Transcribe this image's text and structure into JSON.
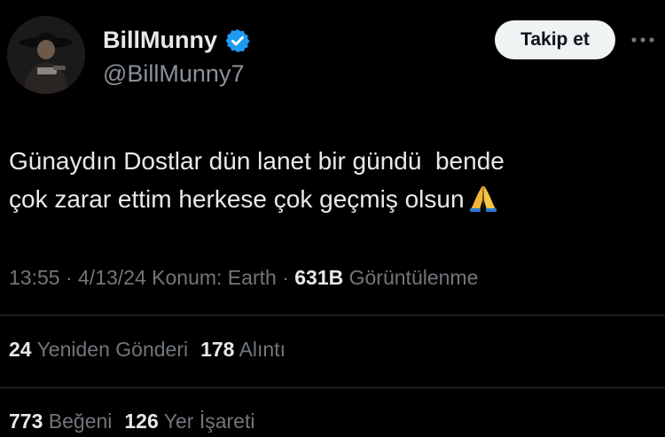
{
  "author": {
    "display_name": "BillMunny",
    "handle": "@BillMunny7",
    "verified_icon": "verified-badge-icon",
    "verified_color": "#1d9bf0"
  },
  "actions": {
    "follow_label": "Takip et",
    "more_icon": "more-horizontal-icon"
  },
  "tweet": {
    "line1": "Günaydın Dostlar dün lanet bir gündü  bende",
    "line2": "çok zarar ettim herkese çok geçmiş olsun",
    "emoji_icon": "folded-hands-emoji"
  },
  "meta": {
    "time": "13:55",
    "separator": "·",
    "date": "4/13/24",
    "location": "Konum: Earth",
    "views_count": "631B",
    "views_label": "Görüntülenme"
  },
  "stats": {
    "reposts_count": "24",
    "reposts_label": "Yeniden Gönderi",
    "quotes_count": "178",
    "quotes_label": "Alıntı",
    "likes_count": "773",
    "likes_label": "Beğeni",
    "bookmarks_count": "126",
    "bookmarks_label": "Yer İşareti"
  },
  "colors": {
    "background": "#000000",
    "primary_text": "#e7e9ea",
    "secondary_text": "#71767b",
    "divider": "#2f3336",
    "follow_button_bg": "#eff3f4"
  }
}
